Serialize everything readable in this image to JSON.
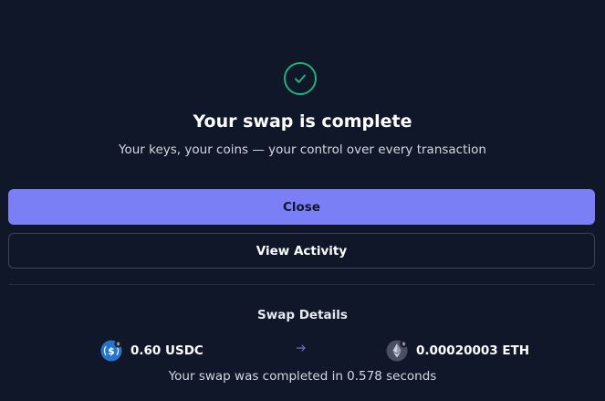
{
  "status": {
    "icon": "check-circle-icon",
    "title": "Your swap is complete",
    "subtitle": "Your keys, your coins — your control over every transaction"
  },
  "actions": {
    "close_label": "Close",
    "view_activity_label": "View Activity"
  },
  "details": {
    "title": "Swap Details",
    "from": {
      "amount": "0.60 USDC",
      "icon": "usdc-token-icon"
    },
    "arrow_icon": "arrow-right-icon",
    "to": {
      "amount": "0.00020003 ETH",
      "icon": "eth-token-icon"
    },
    "completion_note": "Your swap was completed in 0.578 seconds"
  },
  "colors": {
    "background": "#0f1729",
    "success": "#22b07d",
    "primary_button": "#7b7ff5",
    "border": "#3b4354"
  }
}
